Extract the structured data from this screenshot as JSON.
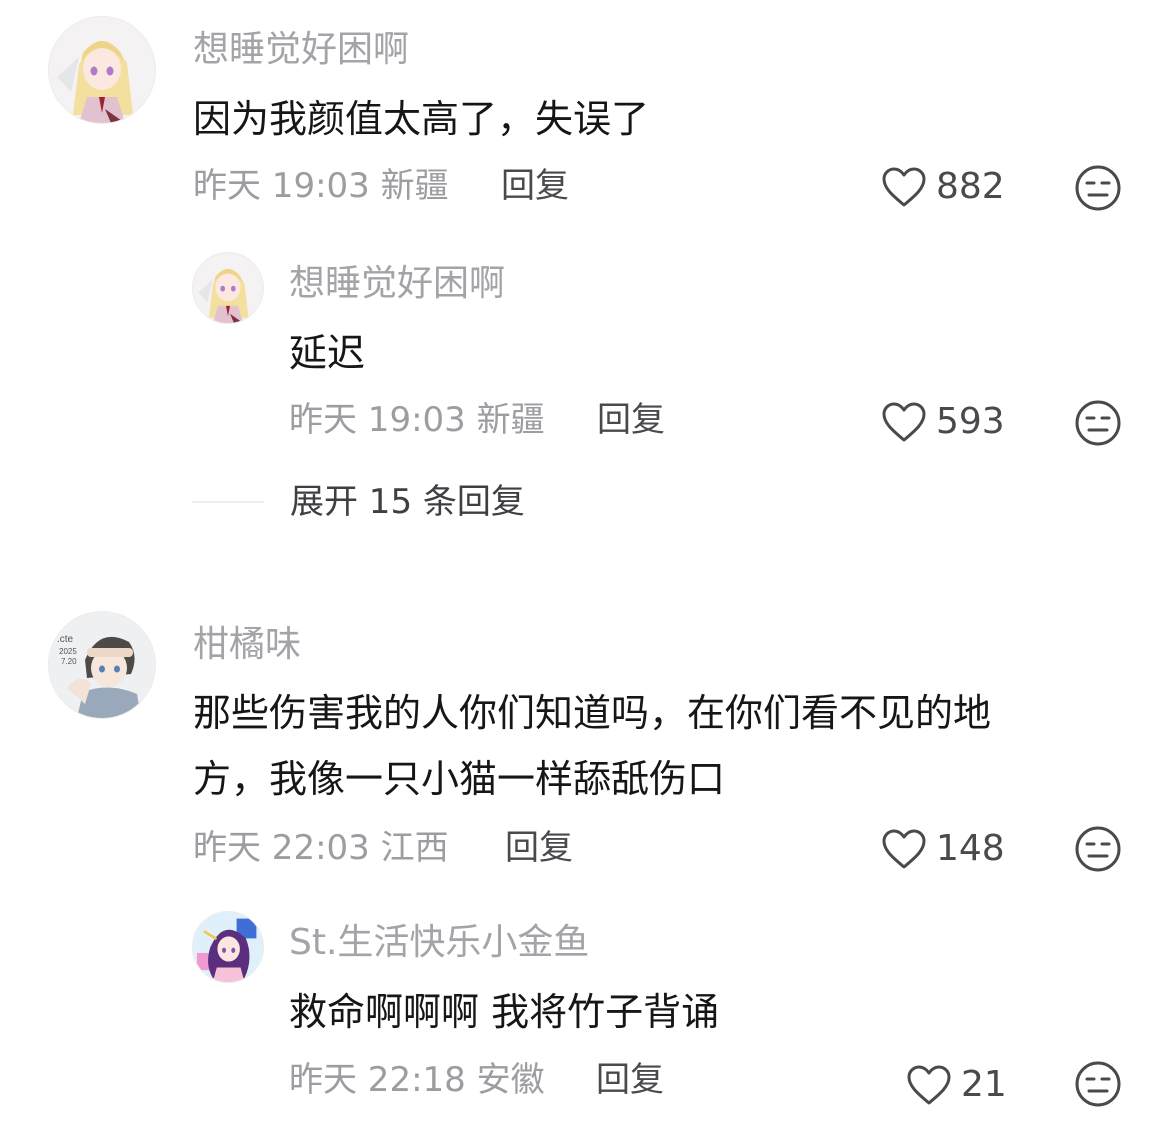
{
  "comments": [
    {
      "username": "想睡觉好困啊",
      "content": "因为我颜值太高了，失误了",
      "time": "昨天 19:03",
      "location": "新疆",
      "reply_label": "回复",
      "likes": "882",
      "replies": [
        {
          "username": "想睡觉好困啊",
          "content": "延迟",
          "time": "昨天 19:03",
          "location": "新疆",
          "reply_label": "回复",
          "likes": "593"
        }
      ],
      "expand_label": "展开 15 条回复"
    },
    {
      "username": "柑橘味",
      "content_line1": "那些伤害我的人你们知道吗，在你们看不见的地",
      "content_line2": "方，我像一只小猫一样舔舐伤口",
      "time": "昨天 22:03",
      "location": "江西",
      "reply_label": "回复",
      "likes": "148",
      "replies": [
        {
          "username": "St.生活快乐小金鱼",
          "content": "救命啊啊啊 我将竹子背诵",
          "time": "昨天 22:18",
          "location": "安徽",
          "reply_label": "回复",
          "likes": "21"
        }
      ]
    }
  ],
  "icons": {
    "like": "heart-outline-icon",
    "dislike": "neutral-face-icon"
  },
  "colors": {
    "username": "#a3a3a8",
    "content": "#161616",
    "meta": "#9c9ca1",
    "action": "#4a4a4e"
  }
}
